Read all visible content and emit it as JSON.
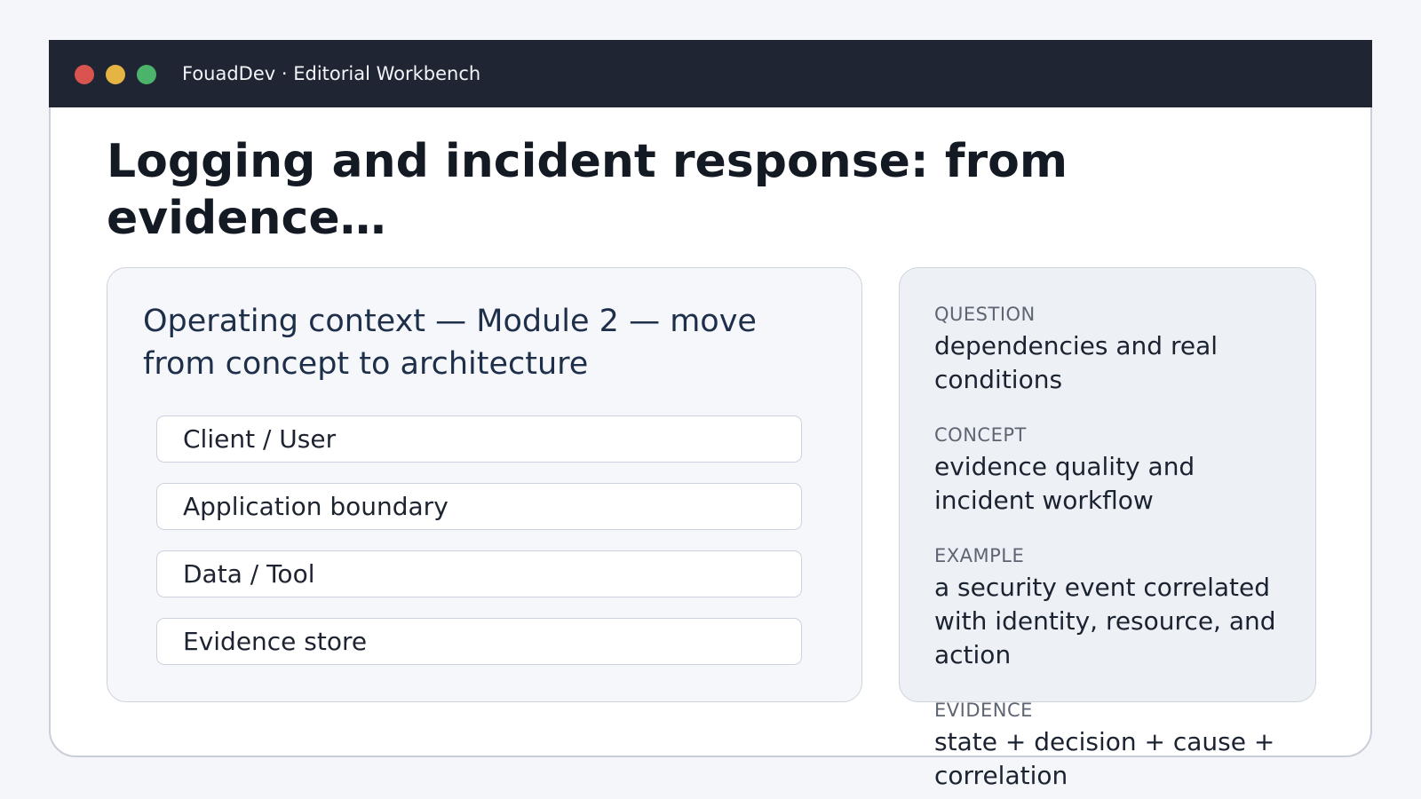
{
  "window": {
    "title": "FouadDev · Editorial Workbench"
  },
  "page": {
    "headline": "Logging and incident response: from evidence…"
  },
  "context_panel": {
    "title": "Operating context — Module 2 — move from concept to architecture",
    "items": [
      {
        "label": "Client / User"
      },
      {
        "label": "Application boundary"
      },
      {
        "label": "Data / Tool"
      },
      {
        "label": "Evidence store"
      }
    ]
  },
  "notes_panel": {
    "sections": [
      {
        "label": "QUESTION",
        "text": "dependencies and real conditions"
      },
      {
        "label": "CONCEPT",
        "text": "evidence quality and incident workflow"
      },
      {
        "label": "EXAMPLE",
        "text": "a security event correlated with identity, resource, and action"
      },
      {
        "label": "EVIDENCE",
        "text": "state + decision + cause + correlation"
      }
    ]
  },
  "colors": {
    "titlebar": "#1f2532",
    "close_dot": "#d9534f",
    "minimize_dot": "#e5b443",
    "zoom_dot": "#4cb36a"
  }
}
